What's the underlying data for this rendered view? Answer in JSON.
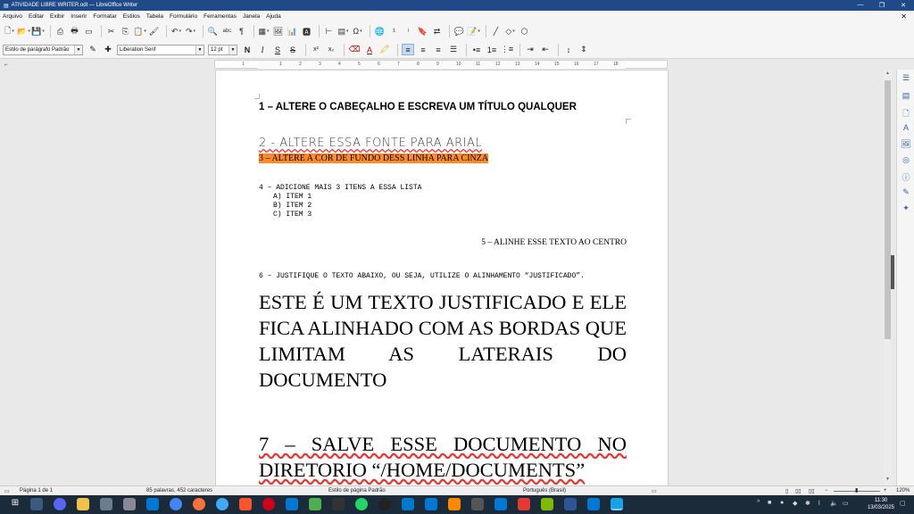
{
  "window": {
    "title": "ATIVIDADE LIBRE WRITER.odt — LibreOffice Writer",
    "min": "—",
    "max": "❐",
    "close": "✕"
  },
  "menu": [
    "Arquivo",
    "Editar",
    "Exibir",
    "Inserir",
    "Formatar",
    "Estilos",
    "Tabela",
    "Formulário",
    "Ferramentas",
    "Janela",
    "Ajuda"
  ],
  "formatting": {
    "paragraph_style": "Estilo de parágrafo Padrão",
    "font_name": "Liberation Serif",
    "font_size": "12 pt",
    "bold": "N",
    "italic": "I",
    "underline": "S",
    "strike": "S",
    "superscript": "x²",
    "subscript": "x₂"
  },
  "document": {
    "line1": "1 – ALTERE O CABEÇALHO E ESCREVA UM TÍTULO QUALQUER",
    "line2": "2 - ALTERE ESSA FONTE PARA ARIAL",
    "line3": "3 – ALTERE A COR DE FUNDO DESS LINHA PARA CINZA",
    "line4": "4 – ADICIONE MAIS 3 ITENS A ESSA LISTA",
    "list": [
      "A) ITEM 1",
      "B) ITEM 2",
      "C) ITEM 3"
    ],
    "line5": "5 – ALINHE ESSE TEXTO AO CENTRO",
    "line6": "6 – JUSTIFIQUE O TEXTO ABAIXO, OU SEJA, UTILIZE O ALINHAMENTO “JUSTIFICADO”.",
    "justified_text": "ESTE É UM TEXTO JUSTIFICADO E ELE FICA ALINHADO COM AS BORDAS QUE LIMITAM AS LATERAIS DO DOCUMENTO",
    "line7": "7 – SALVE ESSE DOCUMENTO NO DIRETORIO “/HOME/DOCUMENTS”"
  },
  "ruler_ticks": [
    "1",
    "1",
    "2",
    "3",
    "4",
    "5",
    "6",
    "7",
    "8",
    "9",
    "10",
    "11",
    "12",
    "13",
    "14",
    "15",
    "16",
    "17",
    "18"
  ],
  "status": {
    "page": "Página 1 de 1",
    "words": "85 palavras, 452 caracteres",
    "page_style": "Estilo de página Padrão",
    "language": "Português (Brasil)",
    "zoom": "120%"
  },
  "clock": {
    "time": "11:30",
    "date": "13/03/2025"
  },
  "colors": {
    "accent": "#204a87",
    "highlight": "#ff8c28",
    "taskbar": "#1c2b3a"
  }
}
